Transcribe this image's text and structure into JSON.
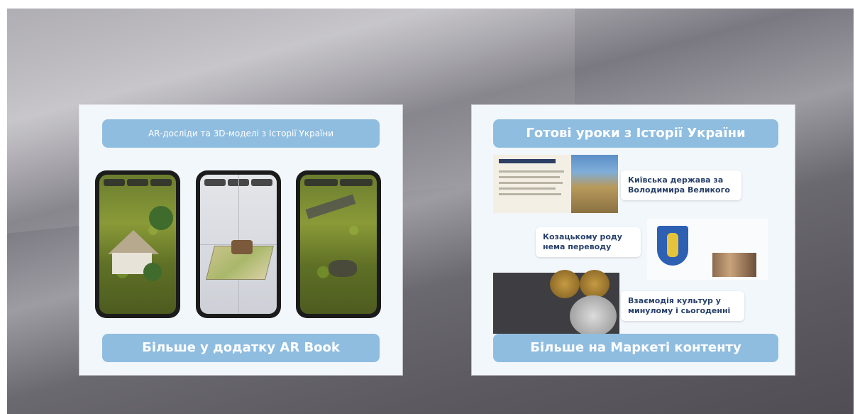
{
  "card_left": {
    "top_banner": "AR-досліди та 3D-моделі з Історії України",
    "bottom_banner": "Більше у додатку AR Book"
  },
  "card_right": {
    "top_banner": "Готові уроки з Історії України",
    "lessons": [
      "Київська держава за Володимира Великого",
      "Козацькому роду нема переводу",
      "Взаємодія культур у минулому і сьогоденні"
    ],
    "bottom_banner": "Більше на Маркеті контенту"
  },
  "colors": {
    "banner": "#8fbde0",
    "card": "#f2f7fc",
    "label_text": "#28406a"
  }
}
